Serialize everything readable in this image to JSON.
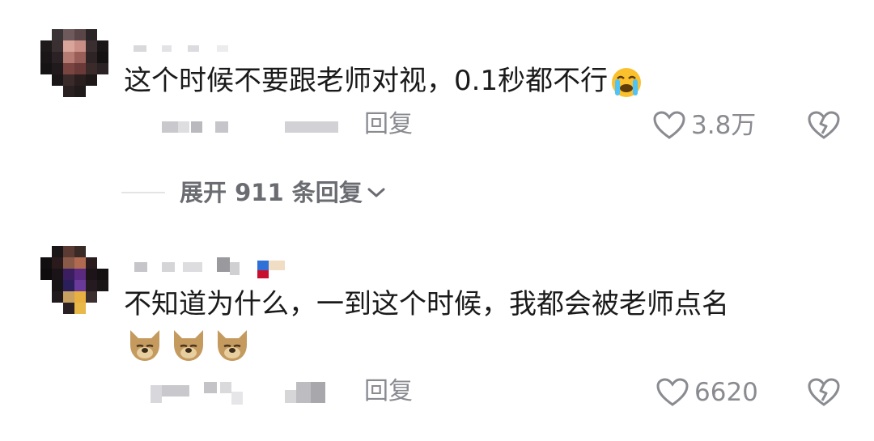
{
  "comments": [
    {
      "text": "这个时候不要跟老师对视，0.1秒都不行",
      "emoji": "loudly-crying-face",
      "reply_label": "回复",
      "likes": "3.8万"
    },
    {
      "text": "不知道为什么，一到这个时候，我都会被老师点名",
      "emoji": "wolf-face x3",
      "reply_label": "回复",
      "likes": "6620"
    }
  ],
  "expand": {
    "label": "展开 911 条回复"
  },
  "colors": {
    "text": "#1a1a1a",
    "muted": "#8a8b91",
    "background": "#ffffff"
  }
}
